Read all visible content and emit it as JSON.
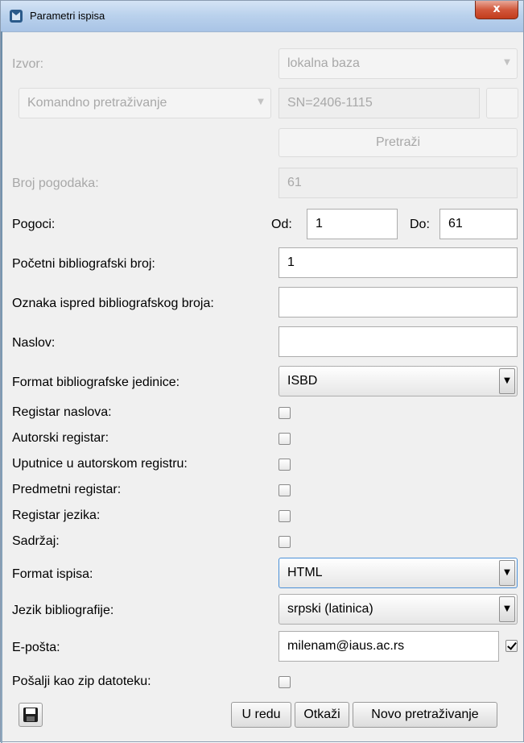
{
  "window": {
    "title": "Parametri ispisa",
    "close_label": "x"
  },
  "izvor": {
    "label": "Izvor:",
    "value": "lokalna baza"
  },
  "search": {
    "mode": "Komandno pretraživanje",
    "query": "SN=2406-1115",
    "search_button": "Pretraži"
  },
  "hits": {
    "label": "Broj pogodaka:",
    "value": "61"
  },
  "pogoci": {
    "label": "Pogoci:",
    "from_label": "Od:",
    "from_value": "1",
    "to_label": "Do:",
    "to_value": "61"
  },
  "start_number": {
    "label": "Početni bibliografski broj:",
    "value": "1"
  },
  "prefix": {
    "label": "Oznaka ispred bibliografskog broja:",
    "value": ""
  },
  "naslov": {
    "label": "Naslov:",
    "value": ""
  },
  "format_unit": {
    "label": "Format bibliografske jedinice:",
    "value": "ISBD"
  },
  "checkboxes": [
    {
      "label": "Registar naslova:",
      "checked": false
    },
    {
      "label": "Autorski registar:",
      "checked": false
    },
    {
      "label": "Uputnice u autorskom registru:",
      "checked": false
    },
    {
      "label": "Predmetni registar:",
      "checked": false
    },
    {
      "label": "Registar jezika:",
      "checked": false
    },
    {
      "label": "Sadržaj:",
      "checked": false
    }
  ],
  "format_output": {
    "label": "Format ispisa:",
    "value": "HTML"
  },
  "language": {
    "label": "Jezik bibliografije:",
    "value": "srpski (latinica)"
  },
  "email": {
    "label": "E-pošta:",
    "value": "milenam@iaus.ac.rs",
    "enabled": true
  },
  "zip": {
    "label": "Pošalji kao zip datoteku:",
    "checked": false
  },
  "footer": {
    "ok": "U redu",
    "cancel": "Otkaži",
    "new_search": "Novo pretraživanje"
  },
  "icons": {
    "app": "app-icon",
    "save": "save-icon",
    "dropdown": "chevron-down-icon"
  }
}
